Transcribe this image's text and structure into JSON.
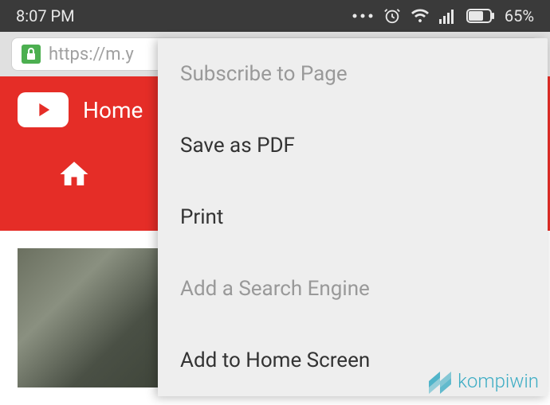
{
  "statusBar": {
    "time": "8:07 PM",
    "batteryPercent": "65%"
  },
  "urlBar": {
    "url": "https://m.y"
  },
  "pageHeader": {
    "homeLabel": "Home"
  },
  "menu": {
    "items": [
      {
        "label": "Subscribe to Page",
        "disabled": true
      },
      {
        "label": "Save as PDF",
        "disabled": false
      },
      {
        "label": "Print",
        "disabled": false
      },
      {
        "label": "Add a Search Engine",
        "disabled": true
      },
      {
        "label": "Add to Home Screen",
        "disabled": false
      }
    ]
  },
  "watermark": {
    "text": "kompiwin"
  }
}
